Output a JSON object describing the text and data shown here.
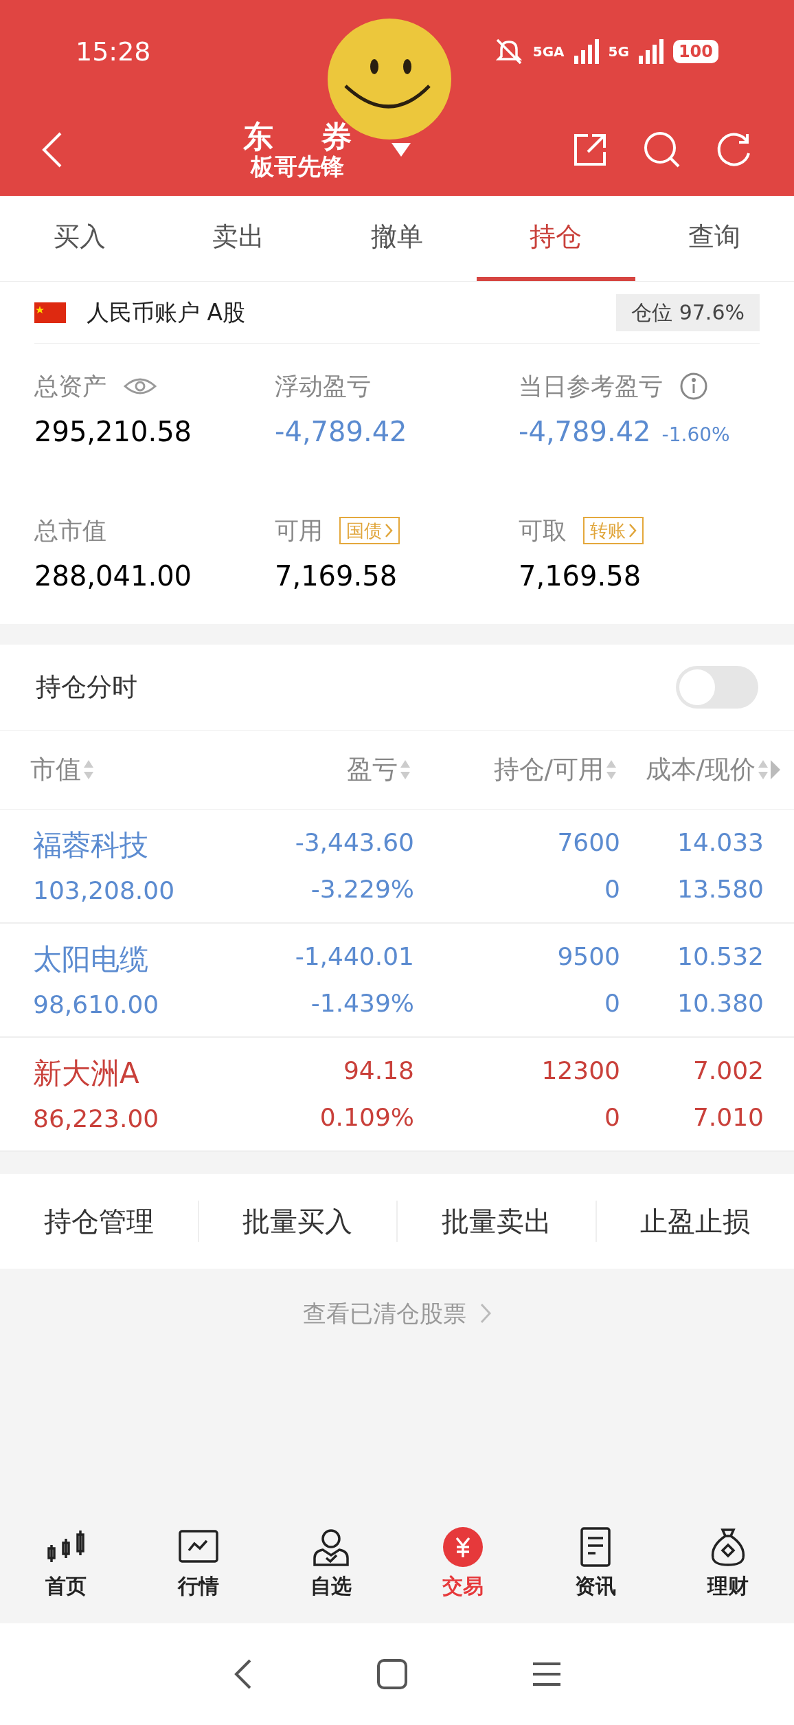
{
  "status_bar": {
    "time": "15:28",
    "network_1": "5GA",
    "network_2": "5G",
    "battery": "100"
  },
  "header": {
    "title_parts": [
      "东",
      "券"
    ],
    "subtitle": "板哥先锋"
  },
  "tabs": [
    {
      "label": "买入",
      "selected": false
    },
    {
      "label": "卖出",
      "selected": false
    },
    {
      "label": "撤单",
      "selected": false
    },
    {
      "label": "持仓",
      "selected": true
    },
    {
      "label": "查询",
      "selected": false
    }
  ],
  "account": {
    "name": "人民币账户 A股",
    "position": "仓位 97.6%"
  },
  "stats": [
    {
      "label": "总资产",
      "value": "295,210.58",
      "kind": "plain"
    },
    {
      "label": "浮动盈亏",
      "value": "-4,789.42",
      "kind": "loss"
    },
    {
      "label": "当日参考盈亏",
      "value": "-4,789.42",
      "extra": "-1.60%",
      "kind": "loss"
    },
    {
      "label": "总市值",
      "value": "288,041.00",
      "kind": "plain"
    },
    {
      "label": "可用",
      "tag": "国债",
      "value": "7,169.58",
      "kind": "plain"
    },
    {
      "label": "可取",
      "tag": "转账",
      "value": "7,169.58",
      "kind": "plain"
    }
  ],
  "intraday": {
    "label": "持仓分时",
    "on": false
  },
  "table": {
    "columns": [
      "市值",
      "盈亏",
      "持仓/可用",
      "成本/现价"
    ],
    "rows": [
      {
        "name": "福蓉科技",
        "market_value": "103,208.00",
        "pnl": "-3,443.60",
        "pnl_pct": "-3.229%",
        "holding": "7600",
        "available": "0",
        "cost": "14.033",
        "price": "13.580",
        "kind": "loss"
      },
      {
        "name": "太阳电缆",
        "market_value": "98,610.00",
        "pnl": "-1,440.01",
        "pnl_pct": "-1.439%",
        "holding": "9500",
        "available": "0",
        "cost": "10.532",
        "price": "10.380",
        "kind": "loss"
      },
      {
        "name": "新大洲A",
        "market_value": "86,223.00",
        "pnl": "94.18",
        "pnl_pct": "0.109%",
        "holding": "12300",
        "available": "0",
        "cost": "7.002",
        "price": "7.010",
        "kind": "gain"
      }
    ]
  },
  "actions": [
    "持仓管理",
    "批量买入",
    "批量卖出",
    "止盈止损"
  ],
  "cleared_link": "查看已清仓股票",
  "bottom_nav": [
    {
      "label": "首页",
      "selected": false
    },
    {
      "label": "行情",
      "selected": false
    },
    {
      "label": "自选",
      "selected": false
    },
    {
      "label": "交易",
      "selected": true
    },
    {
      "label": "资讯",
      "selected": false
    },
    {
      "label": "理财",
      "selected": false
    }
  ]
}
